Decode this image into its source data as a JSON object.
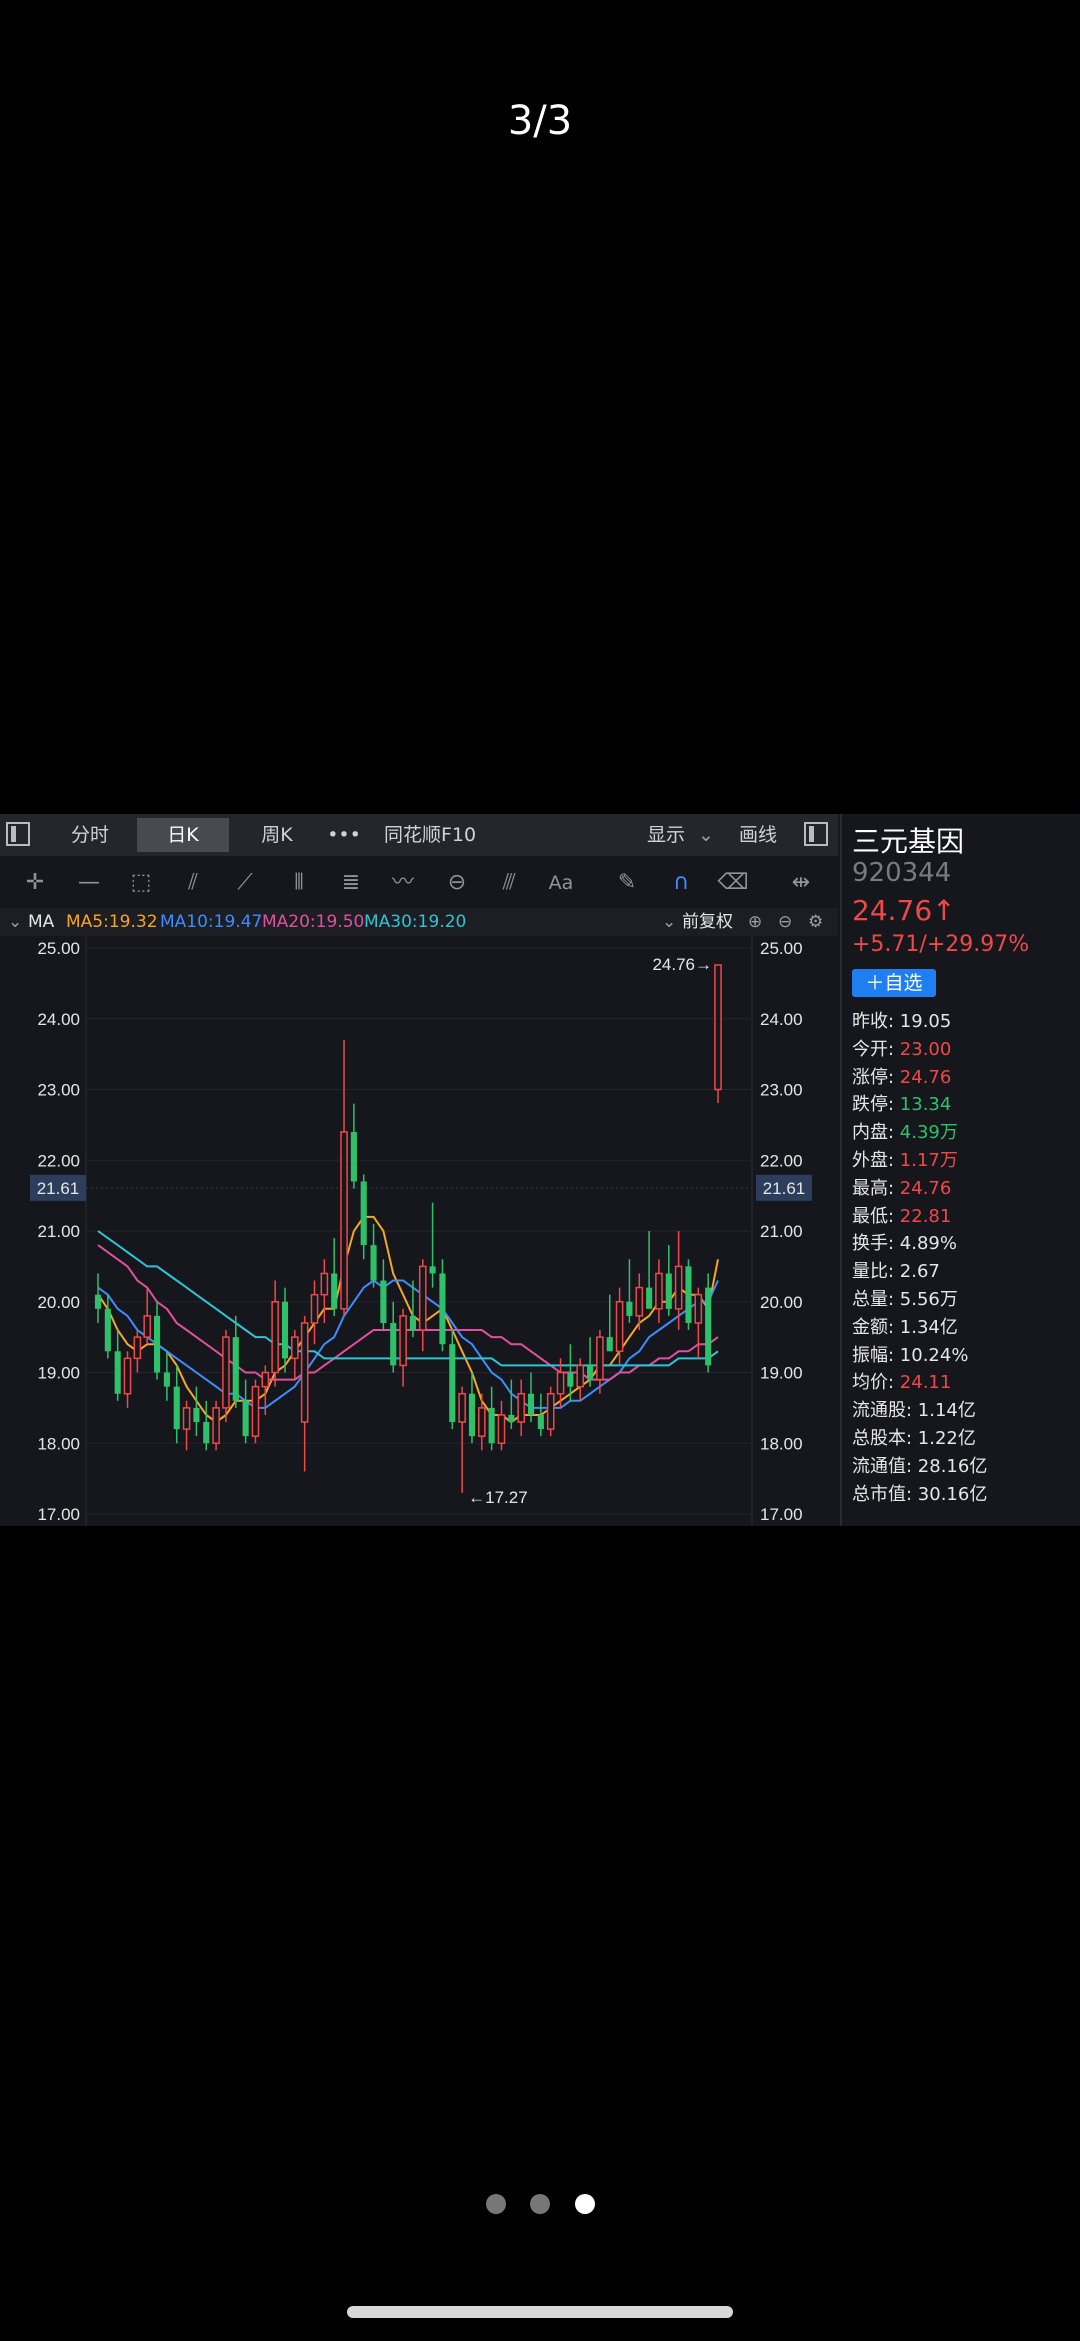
{
  "pager": {
    "counter": "3/3",
    "page_count": 3,
    "active_page": 3
  },
  "tabs": {
    "intraday": "分时",
    "daily": "日K",
    "weekly": "周K",
    "more": "•••",
    "f10": "同花顺F10",
    "display": "显示",
    "draw": "画线"
  },
  "toolbar": {
    "icons": [
      "crosshair-icon",
      "line-icon",
      "rect-icon",
      "fan-icon",
      "channel-icon",
      "parallel-icon",
      "fib-icon",
      "wave-icon",
      "cycle-icon",
      "pitchfork-icon",
      "text-icon",
      "pen-icon",
      "magnet-icon",
      "trash-icon",
      "fit-icon"
    ],
    "text_tool": "Aa"
  },
  "ma_bar": {
    "label": "MA",
    "ma5": "MA5:19.32",
    "ma10": "MA10:19.47",
    "ma20": "MA20:19.50",
    "ma30": "MA30:19.20",
    "adjust": "前复权"
  },
  "colors": {
    "up": "#f04848",
    "down": "#2fc16a",
    "ma5": "#f6a623",
    "ma10": "#3c8dff",
    "ma20": "#e0509e",
    "ma30": "#2ec4d6"
  },
  "chart_data": {
    "type": "candlestick",
    "y_ticks": [
      "25.00",
      "24.00",
      "23.00",
      "22.00",
      "21.00",
      "20.00",
      "19.00",
      "18.00",
      "17.00"
    ],
    "ylim": [
      17,
      25
    ],
    "current_price_label": "21.61",
    "max_label": "24.76→",
    "min_label": "←17.27",
    "candles": [
      [
        20.1,
        20.4,
        19.7,
        19.9
      ],
      [
        19.9,
        20.1,
        19.2,
        19.3
      ],
      [
        19.3,
        19.6,
        18.6,
        18.7
      ],
      [
        18.7,
        19.3,
        18.5,
        19.2
      ],
      [
        19.2,
        19.6,
        19.0,
        19.5
      ],
      [
        19.5,
        20.2,
        19.4,
        19.8
      ],
      [
        19.8,
        20.0,
        18.9,
        19.0
      ],
      [
        19.0,
        19.3,
        18.6,
        18.8
      ],
      [
        18.8,
        19.1,
        18.0,
        18.2
      ],
      [
        18.2,
        18.6,
        17.9,
        18.5
      ],
      [
        18.5,
        18.8,
        18.1,
        18.3
      ],
      [
        18.3,
        18.6,
        17.9,
        18.0
      ],
      [
        18.0,
        18.6,
        17.9,
        18.5
      ],
      [
        18.5,
        19.6,
        18.3,
        19.5
      ],
      [
        19.5,
        19.8,
        18.5,
        18.6
      ],
      [
        18.6,
        18.9,
        18.0,
        18.1
      ],
      [
        18.1,
        18.9,
        18.0,
        18.8
      ],
      [
        18.8,
        19.1,
        18.4,
        19.0
      ],
      [
        19.0,
        20.3,
        18.8,
        20.0
      ],
      [
        20.0,
        20.2,
        19.0,
        19.2
      ],
      [
        19.2,
        19.6,
        18.9,
        19.5
      ],
      [
        18.3,
        19.8,
        17.6,
        19.7
      ],
      [
        19.7,
        20.3,
        19.4,
        20.1
      ],
      [
        20.1,
        20.6,
        19.7,
        20.4
      ],
      [
        20.4,
        20.9,
        19.8,
        19.9
      ],
      [
        19.9,
        23.7,
        19.8,
        22.4
      ],
      [
        22.4,
        22.8,
        21.6,
        21.7
      ],
      [
        21.7,
        21.8,
        20.6,
        20.8
      ],
      [
        20.8,
        21.1,
        20.2,
        20.3
      ],
      [
        20.3,
        20.6,
        19.6,
        19.7
      ],
      [
        19.7,
        20.0,
        19.0,
        19.1
      ],
      [
        19.1,
        19.9,
        18.8,
        19.8
      ],
      [
        19.8,
        20.3,
        19.5,
        19.6
      ],
      [
        19.6,
        20.6,
        19.3,
        20.5
      ],
      [
        20.5,
        21.4,
        20.2,
        20.4
      ],
      [
        20.4,
        20.6,
        19.3,
        19.4
      ],
      [
        19.4,
        19.6,
        18.2,
        18.3
      ],
      [
        18.3,
        18.8,
        17.3,
        18.7
      ],
      [
        18.7,
        19.0,
        18.0,
        18.1
      ],
      [
        18.1,
        18.7,
        17.9,
        18.5
      ],
      [
        18.5,
        18.8,
        17.9,
        18.0
      ],
      [
        18.0,
        18.6,
        17.9,
        18.4
      ],
      [
        18.4,
        18.9,
        18.2,
        18.3
      ],
      [
        18.3,
        18.9,
        18.1,
        18.7
      ],
      [
        18.7,
        19.0,
        18.3,
        18.4
      ],
      [
        18.4,
        18.7,
        18.1,
        18.2
      ],
      [
        18.2,
        18.8,
        18.1,
        18.7
      ],
      [
        18.7,
        19.2,
        18.5,
        19.0
      ],
      [
        19.0,
        19.4,
        18.6,
        18.8
      ],
      [
        18.8,
        19.2,
        18.6,
        19.1
      ],
      [
        19.1,
        19.5,
        18.8,
        18.9
      ],
      [
        18.9,
        19.6,
        18.7,
        19.5
      ],
      [
        19.5,
        20.1,
        19.3,
        19.3
      ],
      [
        19.3,
        20.2,
        19.1,
        20.0
      ],
      [
        20.0,
        20.6,
        19.7,
        19.8
      ],
      [
        19.8,
        20.4,
        19.6,
        20.2
      ],
      [
        20.2,
        21.0,
        19.9,
        19.9
      ],
      [
        19.9,
        20.6,
        19.7,
        20.4
      ],
      [
        20.4,
        20.8,
        19.8,
        19.9
      ],
      [
        19.9,
        21.0,
        19.6,
        20.5
      ],
      [
        20.5,
        20.6,
        19.6,
        19.7
      ],
      [
        19.7,
        20.2,
        19.2,
        20.1
      ],
      [
        20.2,
        20.4,
        19.0,
        19.1
      ],
      [
        23.0,
        24.76,
        22.81,
        24.76
      ]
    ],
    "series": [
      {
        "name": "MA5",
        "values": [
          20.1,
          19.9,
          19.6,
          19.4,
          19.3,
          19.4,
          19.4,
          19.3,
          19.1,
          18.8,
          18.6,
          18.4,
          18.3,
          18.4,
          18.6,
          18.6,
          18.6,
          18.7,
          19.0,
          19.1,
          19.3,
          19.5,
          19.7,
          19.9,
          19.9,
          20.5,
          21.0,
          21.2,
          21.2,
          21.0,
          20.4,
          20.1,
          19.8,
          19.7,
          19.8,
          19.9,
          19.6,
          19.3,
          19.0,
          18.6,
          18.4,
          18.4,
          18.3,
          18.4,
          18.4,
          18.4,
          18.5,
          18.6,
          18.7,
          18.8,
          18.9,
          19.1,
          19.1,
          19.3,
          19.5,
          19.7,
          19.8,
          20.0,
          20.0,
          20.2,
          20.1,
          20.1,
          19.9,
          20.6
        ]
      },
      {
        "name": "MA10",
        "values": [
          20.2,
          20.1,
          19.9,
          19.8,
          19.6,
          19.5,
          19.4,
          19.3,
          19.2,
          19.1,
          19.0,
          18.9,
          18.8,
          18.7,
          18.7,
          18.6,
          18.5,
          18.5,
          18.6,
          18.7,
          18.8,
          19.0,
          19.2,
          19.4,
          19.5,
          19.8,
          20.0,
          20.2,
          20.3,
          20.2,
          20.3,
          20.3,
          20.2,
          20.1,
          20.0,
          19.9,
          19.7,
          19.5,
          19.4,
          19.2,
          19.0,
          18.9,
          18.7,
          18.6,
          18.5,
          18.5,
          18.5,
          18.5,
          18.6,
          18.6,
          18.7,
          18.8,
          18.9,
          19.0,
          19.2,
          19.3,
          19.5,
          19.6,
          19.7,
          19.8,
          19.9,
          20.0,
          20.0,
          20.3
        ]
      },
      {
        "name": "MA20",
        "values": [
          20.8,
          20.7,
          20.6,
          20.5,
          20.3,
          20.2,
          20.0,
          19.9,
          19.7,
          19.6,
          19.5,
          19.4,
          19.3,
          19.2,
          19.1,
          19.0,
          19.0,
          18.9,
          18.9,
          18.9,
          18.9,
          19.0,
          19.0,
          19.1,
          19.2,
          19.3,
          19.4,
          19.5,
          19.6,
          19.6,
          19.6,
          19.6,
          19.6,
          19.6,
          19.6,
          19.6,
          19.6,
          19.6,
          19.6,
          19.6,
          19.5,
          19.5,
          19.4,
          19.4,
          19.3,
          19.2,
          19.1,
          19.0,
          19.0,
          19.0,
          18.9,
          18.9,
          18.9,
          19.0,
          19.0,
          19.1,
          19.1,
          19.2,
          19.2,
          19.3,
          19.3,
          19.4,
          19.4,
          19.5
        ]
      },
      {
        "name": "MA30",
        "values": [
          21.0,
          20.9,
          20.8,
          20.7,
          20.6,
          20.5,
          20.5,
          20.4,
          20.3,
          20.2,
          20.1,
          20.0,
          19.9,
          19.8,
          19.7,
          19.6,
          19.5,
          19.5,
          19.4,
          19.4,
          19.3,
          19.3,
          19.3,
          19.2,
          19.2,
          19.2,
          19.2,
          19.2,
          19.2,
          19.2,
          19.2,
          19.2,
          19.2,
          19.2,
          19.2,
          19.2,
          19.2,
          19.2,
          19.2,
          19.2,
          19.2,
          19.1,
          19.1,
          19.1,
          19.1,
          19.1,
          19.1,
          19.1,
          19.1,
          19.1,
          19.1,
          19.1,
          19.1,
          19.1,
          19.1,
          19.1,
          19.1,
          19.1,
          19.1,
          19.2,
          19.2,
          19.2,
          19.2,
          19.3
        ]
      }
    ]
  },
  "sidebar": {
    "name": "三元基因",
    "code": "920344",
    "price": "24.76↑",
    "change": "+5.71/+29.97%",
    "watch_button": "＋自选",
    "rows": [
      {
        "key": "昨收:",
        "val": "19.05",
        "tone": "white"
      },
      {
        "key": "今开:",
        "val": "23.00",
        "tone": "red"
      },
      {
        "key": "涨停:",
        "val": "24.76",
        "tone": "red"
      },
      {
        "key": "跌停:",
        "val": "13.34",
        "tone": "green"
      },
      {
        "key": "内盘:",
        "val": "4.39万",
        "tone": "green"
      },
      {
        "key": "外盘:",
        "val": "1.17万",
        "tone": "red"
      },
      {
        "key": "最高:",
        "val": "24.76",
        "tone": "red"
      },
      {
        "key": "最低:",
        "val": "22.81",
        "tone": "red"
      },
      {
        "key": "换手:",
        "val": "4.89%",
        "tone": "white"
      },
      {
        "key": "量比:",
        "val": "2.67",
        "tone": "white"
      },
      {
        "key": "总量:",
        "val": "5.56万",
        "tone": "white"
      },
      {
        "key": "金额:",
        "val": "1.34亿",
        "tone": "white"
      },
      {
        "key": "振幅:",
        "val": "10.24%",
        "tone": "white"
      },
      {
        "key": "均价:",
        "val": "24.11",
        "tone": "red"
      },
      {
        "key": "流通股:",
        "val": "1.14亿",
        "tone": "white"
      },
      {
        "key": "总股本:",
        "val": "1.22亿",
        "tone": "white"
      },
      {
        "key": "流通值:",
        "val": "28.16亿",
        "tone": "white"
      },
      {
        "key": "总市值:",
        "val": "30.16亿",
        "tone": "white"
      }
    ]
  }
}
